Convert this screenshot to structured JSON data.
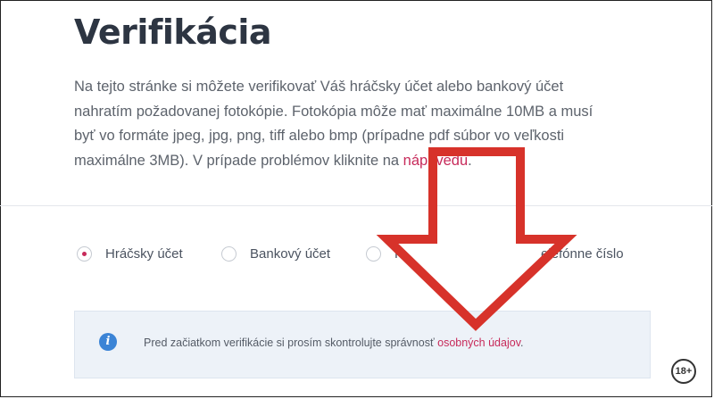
{
  "page": {
    "title": "Verifikácia",
    "description_text": "Na tejto stránke si môžete verifikovať Váš hráčsky účet alebo bankový účet nahratím požadovanej fotokópie. Fotokópia môže mať maximálne 10MB a musí byť vo formáte jpeg, jpg, png, tiff alebo bmp (prípadne pdf súbor vo veľkosti maximálne 3MB). V prípade problémov kliknite na ",
    "help_link": "nápovedu",
    "description_end": "."
  },
  "options": [
    {
      "label": "Hráčsky účet",
      "selected": true
    },
    {
      "label": "Bankový účet",
      "selected": false
    },
    {
      "label": "P",
      "selected": false
    },
    {
      "label": "elefónne číslo",
      "selected": false
    }
  ],
  "notice": {
    "icon": "info-icon",
    "icon_glyph": "i",
    "text": "Pred začiatkom verifikácie si prosím skontrolujte správnosť ",
    "link": "osobných údajov",
    "end": "."
  },
  "overlay": {
    "arrow_color": "#d7322a",
    "age_badge": "18+"
  },
  "colors": {
    "accent": "#c72a5a",
    "info": "#3b84d6",
    "heading": "#2d3542"
  }
}
